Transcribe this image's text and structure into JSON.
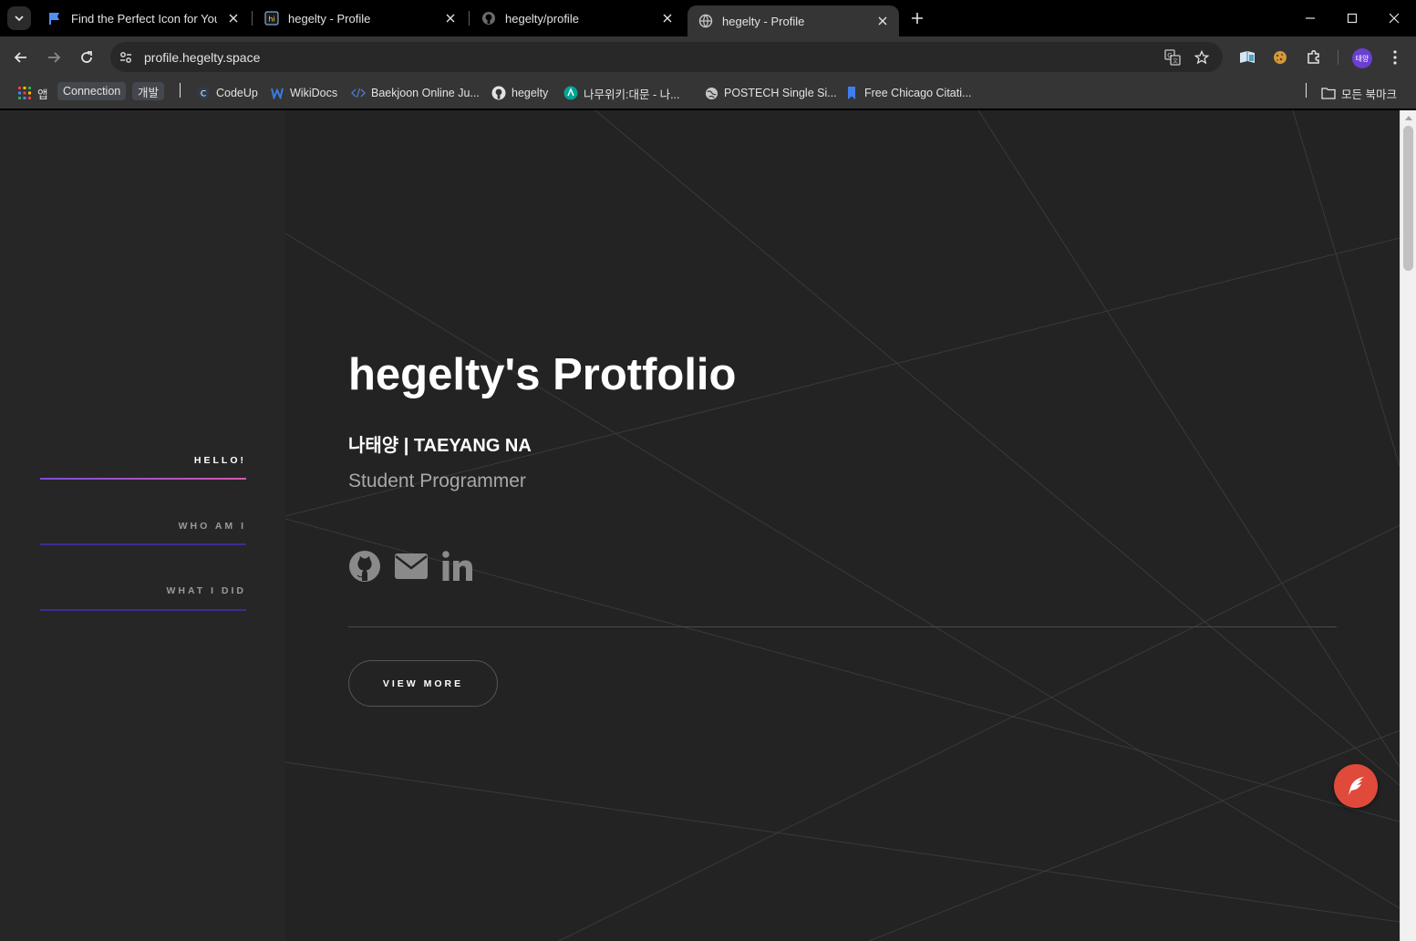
{
  "browser": {
    "tabs": [
      {
        "title": "Find the Perfect Icon for Your Project",
        "favicon": "flag-icon",
        "active": false
      },
      {
        "title": "hegelty - Profile",
        "favicon": "codeup-icon",
        "active": false
      },
      {
        "title": "hegelty/profile",
        "favicon": "github-icon",
        "active": false
      },
      {
        "title": "hegelty - Profile",
        "favicon": "globe-icon",
        "active": true
      }
    ],
    "url": "profile.hegelty.space",
    "bookmarks": {
      "apps_label": "앱",
      "folder_chips": [
        "Connection",
        "개발"
      ],
      "items": [
        {
          "label": "CodeUp",
          "icon": "codeup-icon"
        },
        {
          "label": "WikiDocs",
          "icon": "wikidocs-icon"
        },
        {
          "label": "Baekjoon Online Ju...",
          "icon": "code-icon"
        },
        {
          "label": "hegelty",
          "icon": "github-icon"
        },
        {
          "label": "나무위키:대문 - 나...",
          "icon": "namuwiki-icon"
        },
        {
          "label": "POSTECH Single Si...",
          "icon": "globe-icon"
        },
        {
          "label": "Free Chicago Citati...",
          "icon": "bookmark-icon"
        }
      ],
      "all_bookmarks_label": "모든 북마크"
    },
    "profile_avatar_text": "태양"
  },
  "sidebar": {
    "items": [
      {
        "label": "HELLO!",
        "active": true
      },
      {
        "label": "WHO AM I",
        "active": false
      },
      {
        "label": "WHAT I DID",
        "active": false
      }
    ]
  },
  "hero": {
    "title": "hegelty's Protfolio",
    "name": "나태양 | TAEYANG NA",
    "role": "Student Programmer",
    "social": [
      "github-icon",
      "mail-icon",
      "linkedin-icon"
    ],
    "view_more_label": "VIEW MORE"
  },
  "colors": {
    "page_bg": "#232323",
    "sidebar_bg": "#262626",
    "accent_gradient_start": "#7a4fd6",
    "accent_gradient_end": "#d45ab0",
    "nav_line": "#3a2f8f",
    "fab": "#e04a3b"
  }
}
